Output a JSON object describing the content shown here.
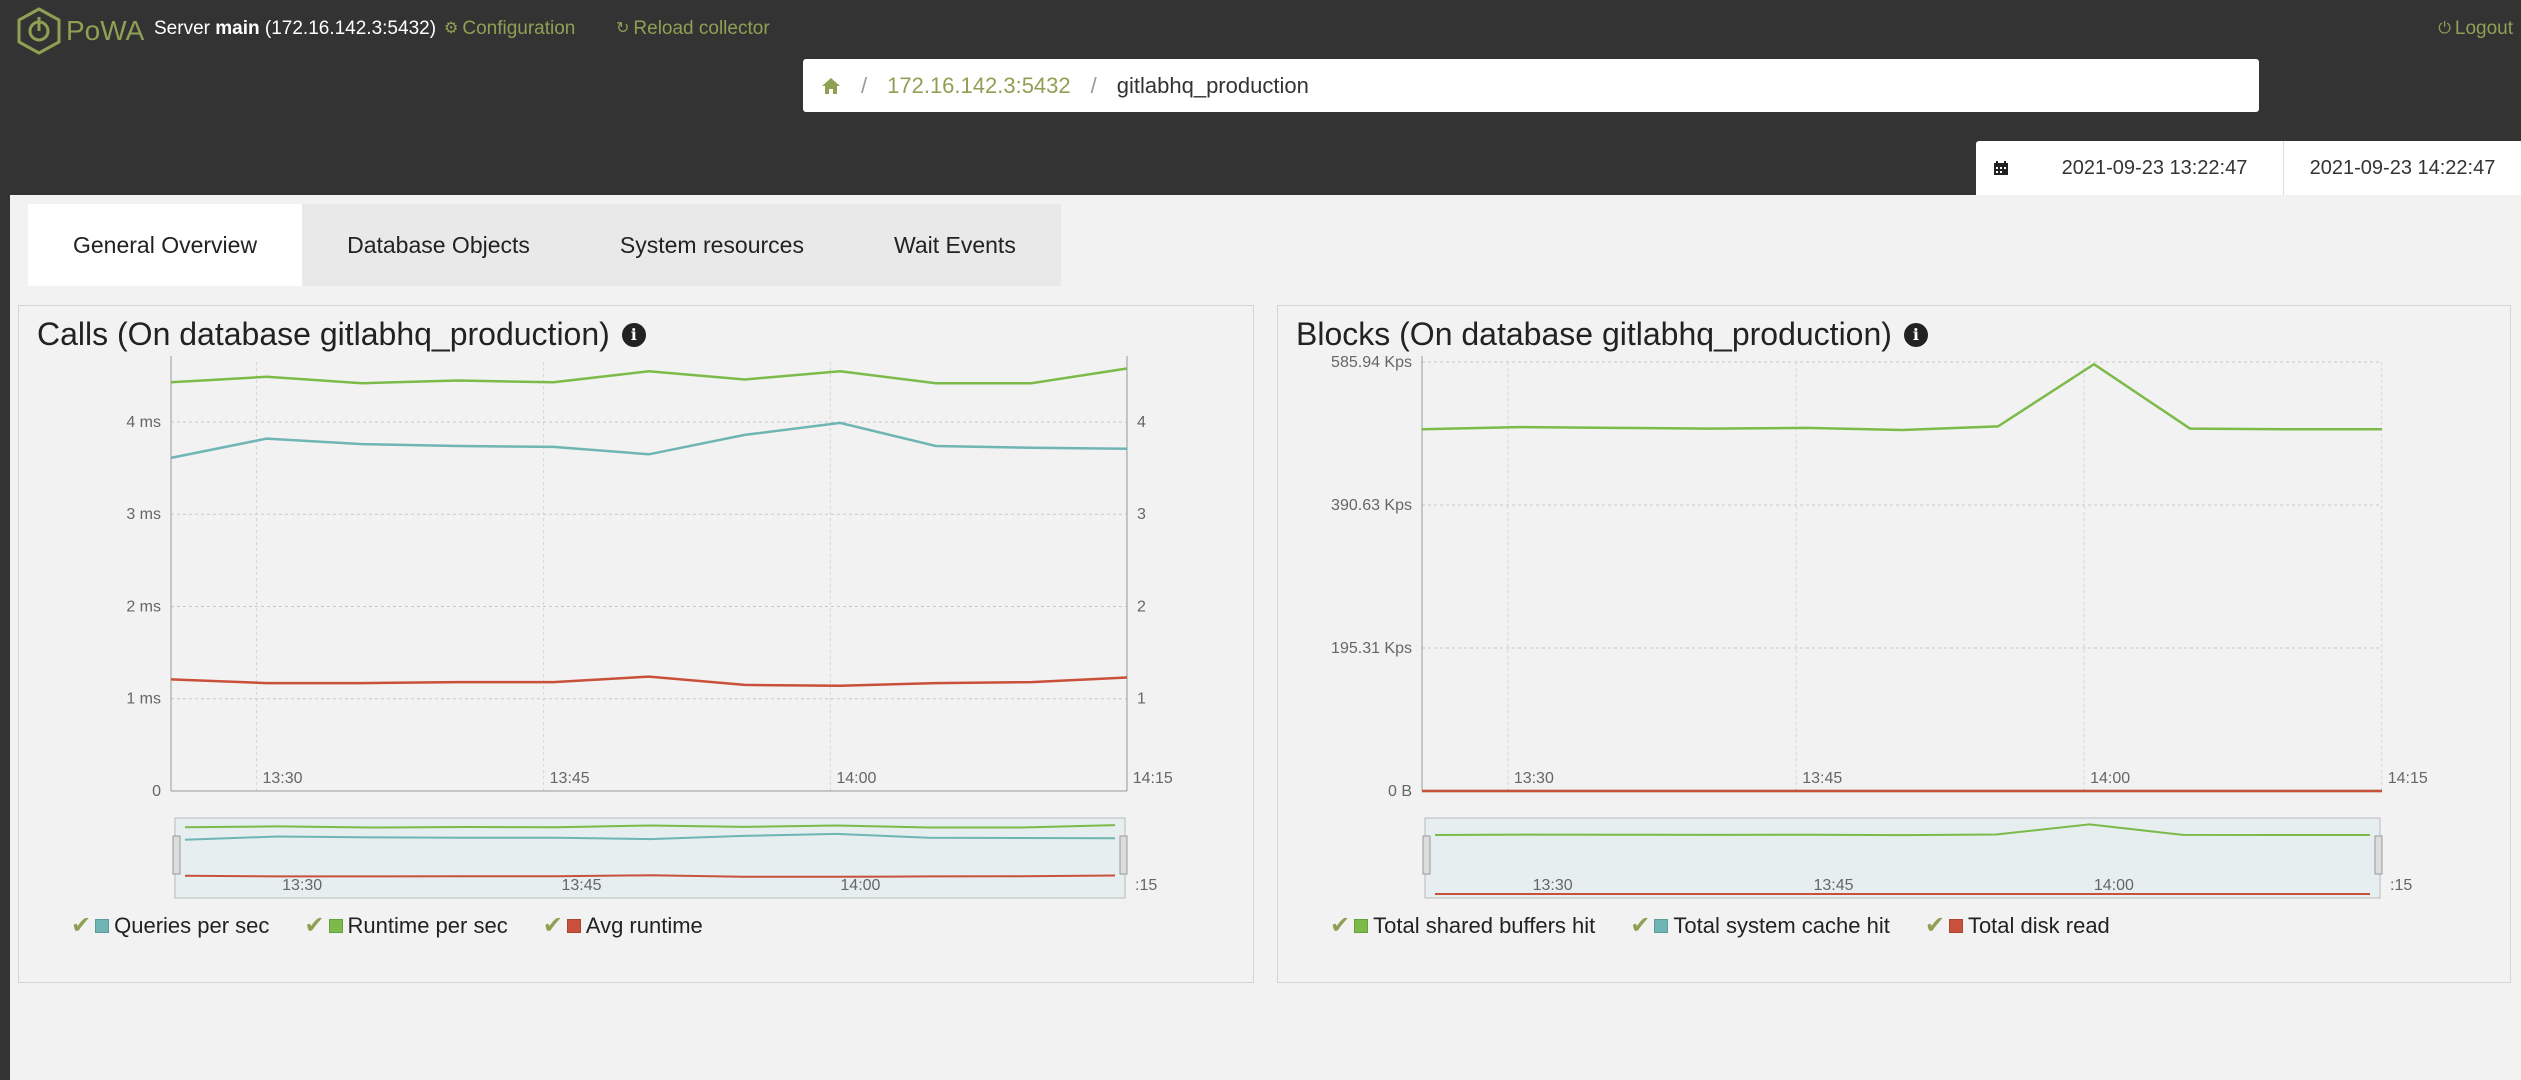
{
  "app": {
    "logo_text": "PoWA"
  },
  "header": {
    "server_prefix": "Server ",
    "server_name": "main",
    "server_addr": " (172.16.142.3:5432)",
    "config_label": "Configuration",
    "reload_label": "Reload collector",
    "logout_label": "Logout",
    "icons": {
      "config": "gear-icon",
      "reload": "refresh-icon",
      "logout": "power-icon"
    }
  },
  "breadcrumb": {
    "server": "172.16.142.3:5432",
    "database": "gitlabhq_production",
    "sep": "/"
  },
  "daterange": {
    "from": "2021-09-23 13:22:47",
    "to": "2021-09-23 14:22:47"
  },
  "tabs": [
    {
      "label": "General Overview",
      "active": true
    },
    {
      "label": "Database Objects"
    },
    {
      "label": "System resources"
    },
    {
      "label": "Wait Events"
    }
  ],
  "colors": {
    "accent": "#8fa054",
    "green": "#7cba4a",
    "teal": "#6fb5b3",
    "red": "#c9503a"
  },
  "calls_card": {
    "title": "Calls (On database gitlabhq_production)",
    "legend": [
      "Queries per sec",
      "Runtime per sec",
      "Avg runtime"
    ]
  },
  "blocks_card": {
    "title": "Blocks (On database gitlabhq_production)",
    "legend": [
      "Total shared buffers hit",
      "Total system cache hit",
      "Total disk read"
    ]
  },
  "chart_data": [
    {
      "type": "line",
      "title": "Calls (On database gitlabhq_production)",
      "x": [
        "13:22",
        "13:30",
        "13:37",
        "13:45",
        "13:52",
        "14:00",
        "14:07",
        "14:15",
        "14:22"
      ],
      "x_ticks": [
        "13:30",
        "13:45",
        "14:00",
        "14:15"
      ],
      "y_ticks_left": [
        "0",
        "1 ms",
        "2 ms",
        "3 ms",
        "4 ms"
      ],
      "y_ticks_right": [
        "1",
        "2",
        "3",
        "4"
      ],
      "ylim_left": [
        0,
        4.65
      ],
      "series": [
        {
          "name": "Queries per sec",
          "color": "#6fb5b3",
          "axis": "right",
          "values": [
            3.61,
            3.82,
            3.76,
            3.74,
            3.73,
            3.65,
            3.86,
            3.99,
            3.74,
            3.72,
            3.71
          ]
        },
        {
          "name": "Runtime per sec",
          "color": "#7cba4a",
          "axis": "right",
          "values": [
            4.43,
            4.49,
            4.42,
            4.45,
            4.43,
            4.55,
            4.46,
            4.55,
            4.42,
            4.42,
            4.58
          ]
        },
        {
          "name": "Avg runtime",
          "color": "#c9503a",
          "axis": "left",
          "values": [
            1.21,
            1.17,
            1.17,
            1.18,
            1.18,
            1.24,
            1.15,
            1.14,
            1.17,
            1.18,
            1.23
          ]
        }
      ],
      "navigator_ticks": [
        "13:30",
        "13:45",
        "14:00",
        ":15"
      ]
    },
    {
      "type": "line",
      "title": "Blocks (On database gitlabhq_production)",
      "x_ticks": [
        "13:30",
        "13:45",
        "14:00",
        "14:15"
      ],
      "y_ticks": [
        "0 B",
        "195.31 Kps",
        "390.63 Kps",
        "585.94 Kps"
      ],
      "ylim": [
        0,
        585.94
      ],
      "series": [
        {
          "name": "Total shared buffers hit",
          "color": "#7cba4a",
          "values": [
            494,
            497,
            496,
            495,
            496,
            493,
            498,
            583,
            495,
            494,
            494
          ]
        },
        {
          "name": "Total system cache hit",
          "color": "#6fb5b3",
          "values": [
            0,
            0,
            0,
            0,
            0,
            0,
            0,
            0,
            0,
            0,
            0
          ]
        },
        {
          "name": "Total disk read",
          "color": "#c9503a",
          "values": [
            0,
            0,
            0,
            0,
            0,
            0,
            0,
            0,
            0,
            0,
            0
          ]
        }
      ],
      "navigator_ticks": [
        "13:30",
        "13:45",
        "14:00",
        ":15"
      ]
    }
  ]
}
